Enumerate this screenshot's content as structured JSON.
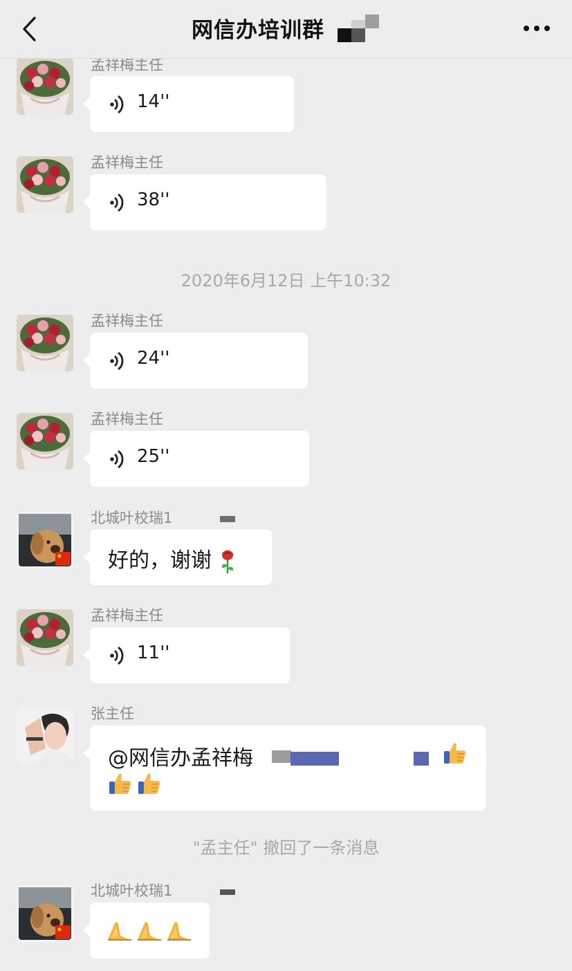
{
  "header": {
    "title": "网信办培训群",
    "back_icon": "chevron-left-icon",
    "more_icon": "ellipsis-icon"
  },
  "messages": [
    {
      "sender": "孟祥梅主任",
      "type": "voice",
      "duration": "14''"
    },
    {
      "sender": "孟祥梅主任",
      "type": "voice",
      "duration": "38''"
    },
    {
      "sender": "孟祥梅主任",
      "type": "voice",
      "duration": "24''"
    },
    {
      "sender": "孟祥梅主任",
      "type": "voice",
      "duration": "25''"
    },
    {
      "sender": "北城叶校瑞1",
      "type": "text",
      "text": "好的，谢谢",
      "emoji": "rose-icon"
    },
    {
      "sender": "孟祥梅主任",
      "type": "voice",
      "duration": "11''"
    },
    {
      "sender": "张主任",
      "type": "text",
      "text": "@网信办孟祥梅",
      "emoji": "thumbs-up-icon"
    },
    {
      "sender": "北城叶校瑞1",
      "type": "emoji",
      "emoji": "folded-hands-icon"
    }
  ],
  "timestamp": "2020年6月12日 上午10:32",
  "recall_notice": "\"孟主任\" 撤回了一条消息",
  "colors": {
    "background": "#ededed",
    "bubble": "#ffffff",
    "meta_text": "#a8a8a8",
    "sender_text": "#8a8a8a"
  }
}
